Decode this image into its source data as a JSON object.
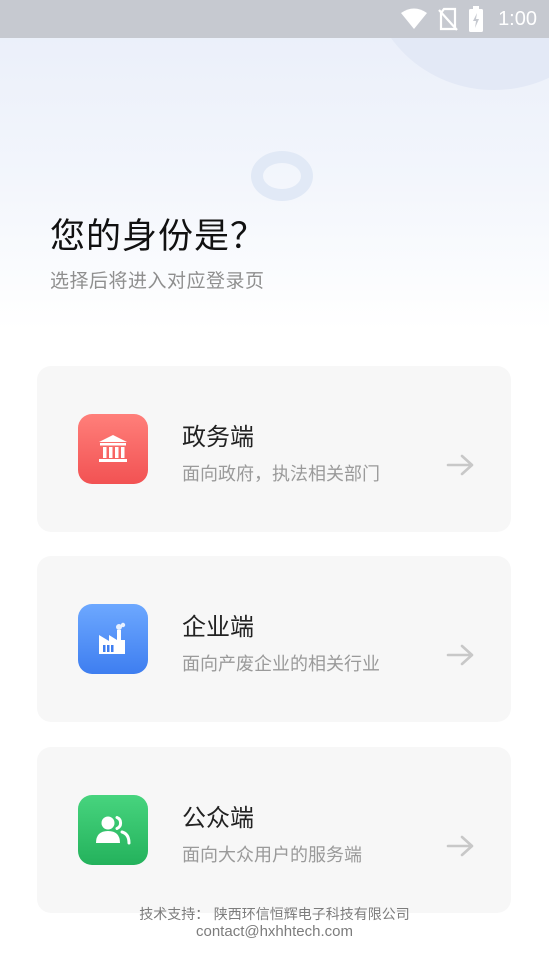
{
  "status_bar": {
    "time": "1:00",
    "icons": [
      "wifi-icon",
      "no-sim-icon",
      "battery-charging-icon"
    ]
  },
  "header": {
    "title": "您的身份是？",
    "subtitle": "选择后将进入对应登录页"
  },
  "cards": [
    {
      "title": "政务端",
      "description": "面向政府，执法相关部门",
      "icon": "government-building-icon",
      "color": "#f25253"
    },
    {
      "title": "企业端",
      "description": "面向产废企业的相关行业",
      "icon": "factory-icon",
      "color": "#3e7ef0"
    },
    {
      "title": "公众端",
      "description": "面向大众用户的服务端",
      "icon": "users-icon",
      "color": "#24b25c"
    }
  ],
  "footer": {
    "support": "技术支持： 陕西环信恒辉电子科技有限公司",
    "contact": "contact@hxhhtech.com"
  }
}
